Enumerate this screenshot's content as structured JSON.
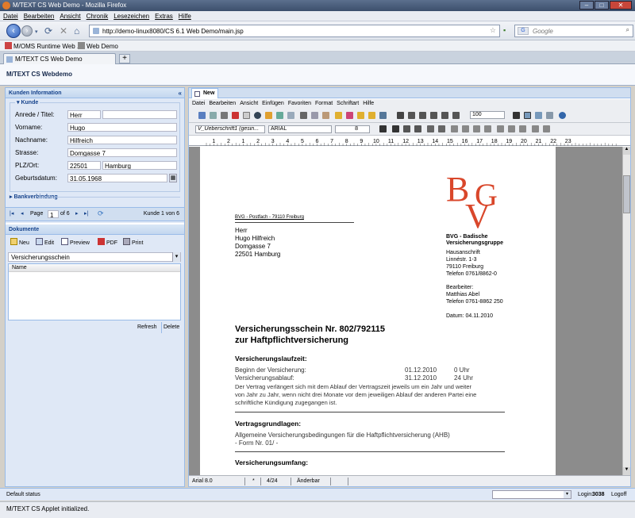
{
  "window": {
    "title": "M/TEXT CS Web Demo - Mozilla Firefox"
  },
  "browser_menu": [
    "Datei",
    "Bearbeiten",
    "Ansicht",
    "Chronik",
    "Lesezeichen",
    "Extras",
    "Hilfe"
  ],
  "address": {
    "url": "http://demo-linux8080/CS 6.1 Web Demo/main.jsp"
  },
  "search": {
    "placeholder": "Google"
  },
  "bookmarks": [
    "M/OMS Runtime Web ...",
    "Web Demo"
  ],
  "tab": {
    "label": "M/TEXT CS Web Demo",
    "new_tab": "+"
  },
  "app": {
    "title": "M/TEXT CS Webdemo"
  },
  "customer_panel": {
    "header": "Kunden Information",
    "section": "Kunde",
    "fields": {
      "anrede_label": "Anrede / Titel:",
      "anrede": "Herr",
      "titel": "",
      "vorname_label": "Vorname:",
      "vorname": "Hugo",
      "nachname_label": "Nachname:",
      "nachname": "Hilfreich",
      "strasse_label": "Strasse:",
      "strasse": "Domgasse 7",
      "plzort_label": "PLZ/Ort:",
      "plz": "22501",
      "ort": "Hamburg",
      "geburtsdatum_label": "Geburtsdatum:",
      "geburtsdatum": "31.05.1968"
    },
    "bank_section": "Bankverbindung",
    "pager": {
      "page_label": "Page",
      "page": "1",
      "of_label": "of 6",
      "status": "Kunde 1 von 6"
    }
  },
  "documents_panel": {
    "header": "Dokumente",
    "toolbar": {
      "new": "Neu",
      "edit": "Edit",
      "preview": "Preview",
      "pdf": "PDF",
      "print": "Print"
    },
    "select_value": "Versicherungsschein",
    "grid_header": "Name",
    "refresh": "Refresh",
    "delete": "Delete"
  },
  "editor": {
    "tab": "New",
    "menu": [
      "Datei",
      "Bearbeiten",
      "Ansicht",
      "Einfügen",
      "Favoriten",
      "Format",
      "Schriftart",
      "Hilfe"
    ],
    "style_select": "V_Ueberschrift1 (gesin...",
    "font_select": "ARIAL",
    "size_select": "8",
    "zoom_select": "100",
    "ruler": [
      "1",
      "2",
      "1",
      "2",
      "3",
      "4",
      "5",
      "6",
      "7",
      "8",
      "9",
      "10",
      "11",
      "12",
      "13",
      "14",
      "15",
      "16",
      "17",
      "18",
      "19",
      "20",
      "21",
      "22",
      "23"
    ],
    "status": {
      "font": "Arial 8.0",
      "star": "*",
      "page": "4/24",
      "mode": "Änderbar"
    }
  },
  "letter": {
    "logo": "BVG",
    "return_address": "BVG - Postfach - 79110 Freiburg",
    "recipient": [
      "Herr",
      "Hugo Hilfreich",
      "Domgasse 7",
      "22501 Hamburg"
    ],
    "company": [
      "BVG - Badische",
      "Versicherungsgruppe"
    ],
    "company_address": [
      "Hausanschrift",
      "Linnéstr. 1-3",
      "79110 Freiburg",
      "Telefon 0761/8862-0"
    ],
    "contact": [
      "Bearbeiter:",
      "Matthias Abel",
      "Telefon 0761-8862 250"
    ],
    "date": "Datum: 04.11.2010",
    "heading1": "Versicherungsschein Nr.  802/792115",
    "heading2": "zur Haftpflichtversicherung",
    "section1": "Versicherungslaufzeit:",
    "beginn_label": "Beginn der Versicherung:",
    "beginn_date": "01.12.2010",
    "beginn_time": "0 Uhr",
    "ablauf_label": "Versicherungsablauf:",
    "ablauf_date": "31.12.2010",
    "ablauf_time": "24 Uhr",
    "body": [
      "Der Vertrag verlängert sich mit dem Ablauf der Vertragszeit jeweils um ein Jahr und weiter",
      "von Jahr zu Jahr, wenn nicht drei Monate vor dem jeweiligen Ablauf der anderen Partei eine",
      "schriftliche Kündigung zugegangen ist."
    ],
    "section2": "Vertragsgrundlagen:",
    "grundlagen": [
      "Allgemeine Versicherungsbedingungen für die Haftpflichtversicherung (AHB)",
      "- Form Nr. 01/ -"
    ],
    "section3": "Versicherungsumfang:"
  },
  "app_status": {
    "left": "Default status",
    "login_label": "Login:",
    "login_value": "3038",
    "logoff": "Logoff"
  },
  "browser_status": "M/TEXT CS Applet initialized.",
  "colors": {
    "accent": "#15428b",
    "logo_red": "#d9472b",
    "panel_bg": "#dfe8f6"
  }
}
